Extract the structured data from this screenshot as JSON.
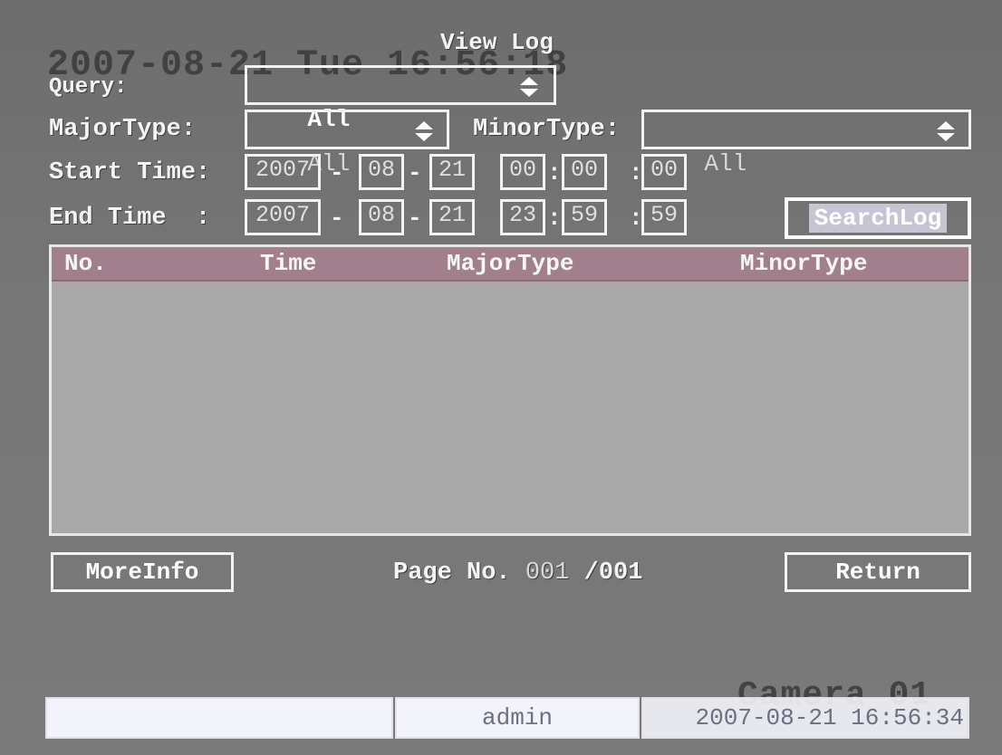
{
  "overlay": {
    "datetime": "2007-08-21 Tue 16:56:18",
    "camera": "Camera 01"
  },
  "dialog": {
    "title": "View Log"
  },
  "query": {
    "label": "Query:",
    "value": "All"
  },
  "major_type": {
    "label": "MajorType:",
    "value": "All"
  },
  "minor_type": {
    "label": "MinorType:",
    "value": "All"
  },
  "start_time": {
    "label": "Start Time:",
    "year": "2007",
    "month": "08",
    "day": "21",
    "hour": "00",
    "minute": "00",
    "second": "00"
  },
  "end_time": {
    "label": "End Time  :",
    "year": "2007",
    "month": "08",
    "day": "21",
    "hour": "23",
    "minute": "59",
    "second": "59"
  },
  "separators": {
    "date": "-",
    "time": ":"
  },
  "search_button": "SearchLog",
  "log_table": {
    "columns": [
      "No.",
      "Time",
      "MajorType",
      "MinorType"
    ],
    "rows": []
  },
  "footer": {
    "more_info_button": "MoreInfo",
    "page_label": "Page No.",
    "page_current": "001",
    "page_total": "/001",
    "return_button": "Return"
  },
  "status_bar": {
    "left": "",
    "user": "admin",
    "datetime": "2007-08-21 16:56:34"
  },
  "icons": {
    "dropdown": "up-down-arrow-icon"
  }
}
